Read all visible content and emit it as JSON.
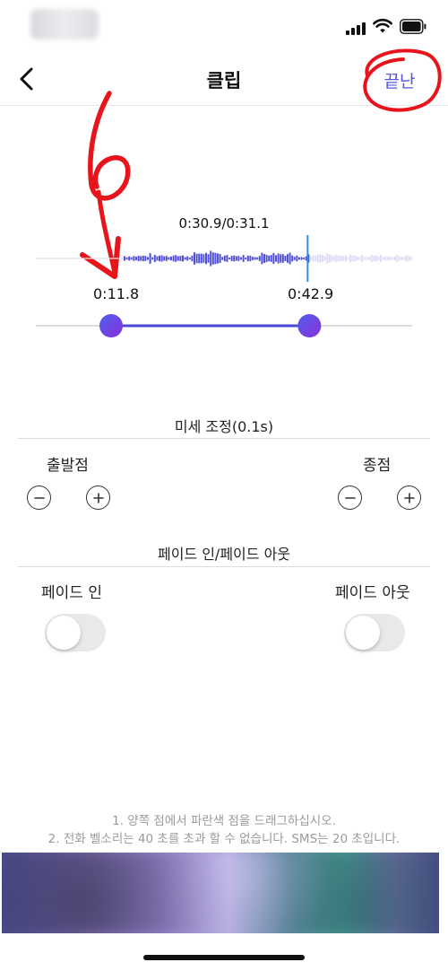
{
  "nav": {
    "title": "클립",
    "done_label": "끝난"
  },
  "clip": {
    "playhead_time": "0:30.9/0:31.1",
    "start_time": "0:11.8",
    "end_time": "0:42.9",
    "range_start_fraction": 0.2,
    "range_end_fraction": 0.727
  },
  "fine_tune": {
    "title": "미세 조정(0.1s)",
    "start_label": "출발점",
    "end_label": "종점"
  },
  "fade": {
    "title": "페이드 인/페이드 아웃",
    "fade_in_label": "페이드 인",
    "fade_out_label": "페이드 아웃",
    "fade_in_on": false,
    "fade_out_on": false
  },
  "annotation": {
    "number": "6"
  },
  "notes": {
    "line1": "1. 양쪽 점에서 파란색 점을 드래그하십시오.",
    "line2": "2. 전화 벨소리는 40 초를 초과 할 수 없습니다. SMS는 20 초입니다."
  },
  "colors": {
    "accent": "#5656d6",
    "waveform_selected": "#5151db",
    "waveform_unselected": "#dcdcf7",
    "playhead": "#2e8ef0",
    "annotation_red": "#e8141b"
  }
}
